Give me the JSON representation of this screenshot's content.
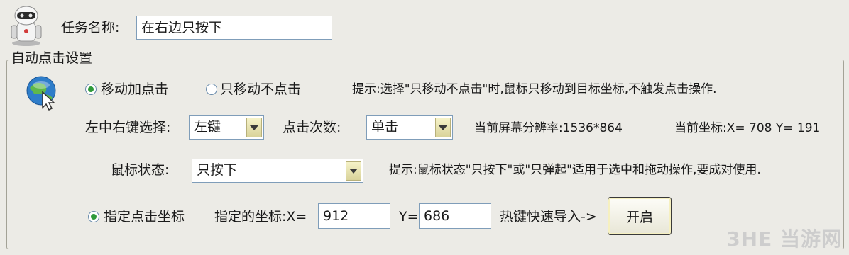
{
  "task": {
    "label": "任务名称:",
    "value": "在右边只按下"
  },
  "group": {
    "title": "自动点击设置"
  },
  "mode": {
    "option_move_click": "移动加点击",
    "option_move_only": "只移动不点击",
    "selected": "移动加点击"
  },
  "hints": {
    "mode_hint": "提示:选择\"只移动不点击\"时,鼠标只移动到目标坐标,不触发点击操作.",
    "state_hint": "提示:鼠标状态\"只按下\"或\"只弹起\"适用于选中和拖动操作,要成对使用."
  },
  "button_select": {
    "label": "左中右键选择:",
    "value": "左键"
  },
  "click_count": {
    "label": "点击次数:",
    "value": "单击"
  },
  "screen": {
    "resolution_text": "当前屏幕分辨率:1536*864",
    "coord_text": "当前坐标:X= 708   Y= 191"
  },
  "mouse_state": {
    "label": "鼠标状态:",
    "value": "只按下"
  },
  "target": {
    "radio_label": "指定点击坐标",
    "coords_label": "指定的坐标:X=",
    "x_value": "912",
    "y_label": "Y=",
    "y_value": "686",
    "hotkey_label": "热键快速导入->",
    "start_button": "开启"
  },
  "watermark": "3HE 当游网",
  "colors": {
    "background": "#ecebe6",
    "input_border": "#7f9db9",
    "radio_dot": "#2f9a3a"
  },
  "icons": [
    "robot-icon",
    "globe-cursor-icon"
  ]
}
